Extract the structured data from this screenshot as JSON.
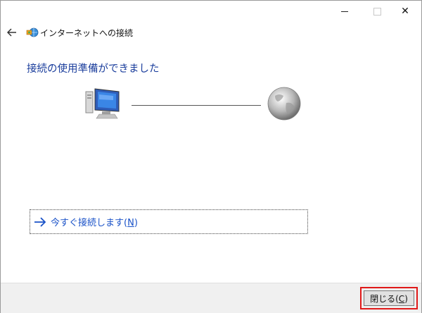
{
  "window": {
    "title_icon": "network-globe-icon",
    "wizard_title": "インターネットへの接続",
    "controls": {
      "minimize": "minimize-icon",
      "maximize": "maximize-icon",
      "close": "✕"
    }
  },
  "nav": {
    "back_icon": "back-arrow-icon"
  },
  "main": {
    "heading": "接続の使用準備ができました",
    "diagram": {
      "left_icon": "computer-icon",
      "right_icon": "globe-icon"
    },
    "connect_now": {
      "label_prefix": "今すぐ接続します(",
      "mnemonic": "N",
      "label_suffix": ")",
      "icon": "arrow-right-icon"
    }
  },
  "footer": {
    "close_button": {
      "label_prefix": "閉じる(",
      "mnemonic": "C",
      "label_suffix": ")"
    }
  },
  "colors": {
    "heading": "#1a3d9c",
    "link": "#1a52c8",
    "highlight_border": "#e01919",
    "footer_bg": "#f0f0f0"
  }
}
